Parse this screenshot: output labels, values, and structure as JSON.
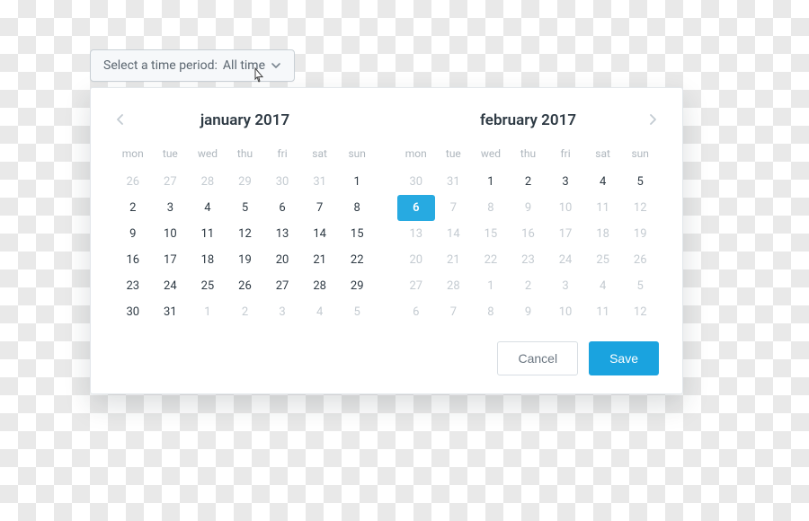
{
  "dropdown": {
    "label": "Select a time period:",
    "value": "All time"
  },
  "dow": [
    "mon",
    "tue",
    "wed",
    "thu",
    "fri",
    "sat",
    "sun"
  ],
  "months": [
    {
      "title": "january 2017",
      "nav": {
        "prev": true,
        "next": false
      },
      "cells": [
        {
          "n": 26,
          "out": true
        },
        {
          "n": 27,
          "out": true
        },
        {
          "n": 28,
          "out": true
        },
        {
          "n": 29,
          "out": true
        },
        {
          "n": 30,
          "out": true
        },
        {
          "n": 31,
          "out": true
        },
        {
          "n": 1
        },
        {
          "n": 2
        },
        {
          "n": 3
        },
        {
          "n": 4
        },
        {
          "n": 5
        },
        {
          "n": 6
        },
        {
          "n": 7
        },
        {
          "n": 8
        },
        {
          "n": 9
        },
        {
          "n": 10
        },
        {
          "n": 11
        },
        {
          "n": 12
        },
        {
          "n": 13
        },
        {
          "n": 14
        },
        {
          "n": 15
        },
        {
          "n": 16
        },
        {
          "n": 17
        },
        {
          "n": 18
        },
        {
          "n": 19
        },
        {
          "n": 20
        },
        {
          "n": 21
        },
        {
          "n": 22
        },
        {
          "n": 23
        },
        {
          "n": 24
        },
        {
          "n": 25
        },
        {
          "n": 26
        },
        {
          "n": 27
        },
        {
          "n": 28
        },
        {
          "n": 29
        },
        {
          "n": 30
        },
        {
          "n": 31
        },
        {
          "n": 1,
          "out": true
        },
        {
          "n": 2,
          "out": true
        },
        {
          "n": 3,
          "out": true
        },
        {
          "n": 4,
          "out": true
        },
        {
          "n": 5,
          "out": true
        }
      ]
    },
    {
      "title": "february 2017",
      "nav": {
        "prev": false,
        "next": true
      },
      "cells": [
        {
          "n": 30,
          "out": true
        },
        {
          "n": 31,
          "out": true
        },
        {
          "n": 1
        },
        {
          "n": 2
        },
        {
          "n": 3
        },
        {
          "n": 4
        },
        {
          "n": 5
        },
        {
          "n": 6,
          "sel": true
        },
        {
          "n": 7,
          "out": true
        },
        {
          "n": 8,
          "out": true
        },
        {
          "n": 9,
          "out": true
        },
        {
          "n": 10,
          "out": true
        },
        {
          "n": 11,
          "out": true
        },
        {
          "n": 12,
          "out": true
        },
        {
          "n": 13,
          "out": true
        },
        {
          "n": 14,
          "out": true
        },
        {
          "n": 15,
          "out": true
        },
        {
          "n": 16,
          "out": true
        },
        {
          "n": 17,
          "out": true
        },
        {
          "n": 18,
          "out": true
        },
        {
          "n": 19,
          "out": true
        },
        {
          "n": 20,
          "out": true
        },
        {
          "n": 21,
          "out": true
        },
        {
          "n": 22,
          "out": true
        },
        {
          "n": 23,
          "out": true
        },
        {
          "n": 24,
          "out": true
        },
        {
          "n": 25,
          "out": true
        },
        {
          "n": 26,
          "out": true
        },
        {
          "n": 27,
          "out": true
        },
        {
          "n": 28,
          "out": true
        },
        {
          "n": 1,
          "out": true
        },
        {
          "n": 2,
          "out": true
        },
        {
          "n": 3,
          "out": true
        },
        {
          "n": 4,
          "out": true
        },
        {
          "n": 5,
          "out": true
        },
        {
          "n": 6,
          "out": true
        },
        {
          "n": 7,
          "out": true
        },
        {
          "n": 8,
          "out": true
        },
        {
          "n": 9,
          "out": true
        },
        {
          "n": 10,
          "out": true
        },
        {
          "n": 11,
          "out": true
        },
        {
          "n": 12,
          "out": true
        }
      ]
    }
  ],
  "buttons": {
    "cancel": "Cancel",
    "save": "Save"
  },
  "colors": {
    "accent": "#1aa3df",
    "selected": "#27aae1"
  }
}
